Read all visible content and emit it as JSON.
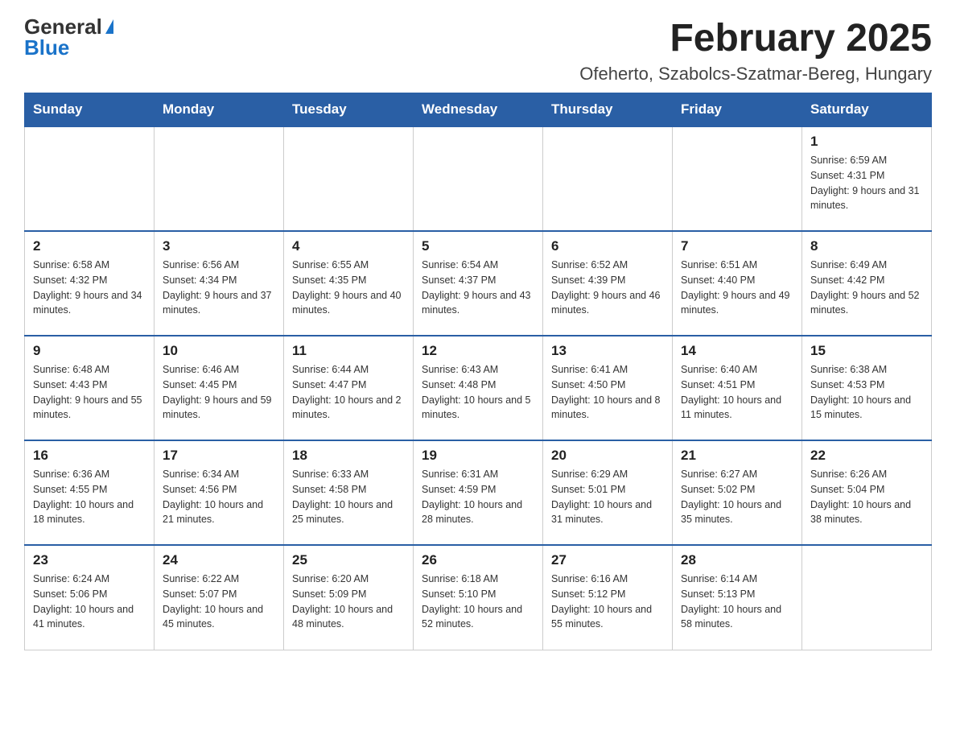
{
  "header": {
    "logo_general": "General",
    "logo_blue": "Blue",
    "month_title": "February 2025",
    "location": "Ofeherto, Szabolcs-Szatmar-Bereg, Hungary"
  },
  "days_of_week": [
    "Sunday",
    "Monday",
    "Tuesday",
    "Wednesday",
    "Thursday",
    "Friday",
    "Saturday"
  ],
  "weeks": [
    [
      {
        "day": "",
        "info": ""
      },
      {
        "day": "",
        "info": ""
      },
      {
        "day": "",
        "info": ""
      },
      {
        "day": "",
        "info": ""
      },
      {
        "day": "",
        "info": ""
      },
      {
        "day": "",
        "info": ""
      },
      {
        "day": "1",
        "info": "Sunrise: 6:59 AM\nSunset: 4:31 PM\nDaylight: 9 hours and 31 minutes."
      }
    ],
    [
      {
        "day": "2",
        "info": "Sunrise: 6:58 AM\nSunset: 4:32 PM\nDaylight: 9 hours and 34 minutes."
      },
      {
        "day": "3",
        "info": "Sunrise: 6:56 AM\nSunset: 4:34 PM\nDaylight: 9 hours and 37 minutes."
      },
      {
        "day": "4",
        "info": "Sunrise: 6:55 AM\nSunset: 4:35 PM\nDaylight: 9 hours and 40 minutes."
      },
      {
        "day": "5",
        "info": "Sunrise: 6:54 AM\nSunset: 4:37 PM\nDaylight: 9 hours and 43 minutes."
      },
      {
        "day": "6",
        "info": "Sunrise: 6:52 AM\nSunset: 4:39 PM\nDaylight: 9 hours and 46 minutes."
      },
      {
        "day": "7",
        "info": "Sunrise: 6:51 AM\nSunset: 4:40 PM\nDaylight: 9 hours and 49 minutes."
      },
      {
        "day": "8",
        "info": "Sunrise: 6:49 AM\nSunset: 4:42 PM\nDaylight: 9 hours and 52 minutes."
      }
    ],
    [
      {
        "day": "9",
        "info": "Sunrise: 6:48 AM\nSunset: 4:43 PM\nDaylight: 9 hours and 55 minutes."
      },
      {
        "day": "10",
        "info": "Sunrise: 6:46 AM\nSunset: 4:45 PM\nDaylight: 9 hours and 59 minutes."
      },
      {
        "day": "11",
        "info": "Sunrise: 6:44 AM\nSunset: 4:47 PM\nDaylight: 10 hours and 2 minutes."
      },
      {
        "day": "12",
        "info": "Sunrise: 6:43 AM\nSunset: 4:48 PM\nDaylight: 10 hours and 5 minutes."
      },
      {
        "day": "13",
        "info": "Sunrise: 6:41 AM\nSunset: 4:50 PM\nDaylight: 10 hours and 8 minutes."
      },
      {
        "day": "14",
        "info": "Sunrise: 6:40 AM\nSunset: 4:51 PM\nDaylight: 10 hours and 11 minutes."
      },
      {
        "day": "15",
        "info": "Sunrise: 6:38 AM\nSunset: 4:53 PM\nDaylight: 10 hours and 15 minutes."
      }
    ],
    [
      {
        "day": "16",
        "info": "Sunrise: 6:36 AM\nSunset: 4:55 PM\nDaylight: 10 hours and 18 minutes."
      },
      {
        "day": "17",
        "info": "Sunrise: 6:34 AM\nSunset: 4:56 PM\nDaylight: 10 hours and 21 minutes."
      },
      {
        "day": "18",
        "info": "Sunrise: 6:33 AM\nSunset: 4:58 PM\nDaylight: 10 hours and 25 minutes."
      },
      {
        "day": "19",
        "info": "Sunrise: 6:31 AM\nSunset: 4:59 PM\nDaylight: 10 hours and 28 minutes."
      },
      {
        "day": "20",
        "info": "Sunrise: 6:29 AM\nSunset: 5:01 PM\nDaylight: 10 hours and 31 minutes."
      },
      {
        "day": "21",
        "info": "Sunrise: 6:27 AM\nSunset: 5:02 PM\nDaylight: 10 hours and 35 minutes."
      },
      {
        "day": "22",
        "info": "Sunrise: 6:26 AM\nSunset: 5:04 PM\nDaylight: 10 hours and 38 minutes."
      }
    ],
    [
      {
        "day": "23",
        "info": "Sunrise: 6:24 AM\nSunset: 5:06 PM\nDaylight: 10 hours and 41 minutes."
      },
      {
        "day": "24",
        "info": "Sunrise: 6:22 AM\nSunset: 5:07 PM\nDaylight: 10 hours and 45 minutes."
      },
      {
        "day": "25",
        "info": "Sunrise: 6:20 AM\nSunset: 5:09 PM\nDaylight: 10 hours and 48 minutes."
      },
      {
        "day": "26",
        "info": "Sunrise: 6:18 AM\nSunset: 5:10 PM\nDaylight: 10 hours and 52 minutes."
      },
      {
        "day": "27",
        "info": "Sunrise: 6:16 AM\nSunset: 5:12 PM\nDaylight: 10 hours and 55 minutes."
      },
      {
        "day": "28",
        "info": "Sunrise: 6:14 AM\nSunset: 5:13 PM\nDaylight: 10 hours and 58 minutes."
      },
      {
        "day": "",
        "info": ""
      }
    ]
  ]
}
